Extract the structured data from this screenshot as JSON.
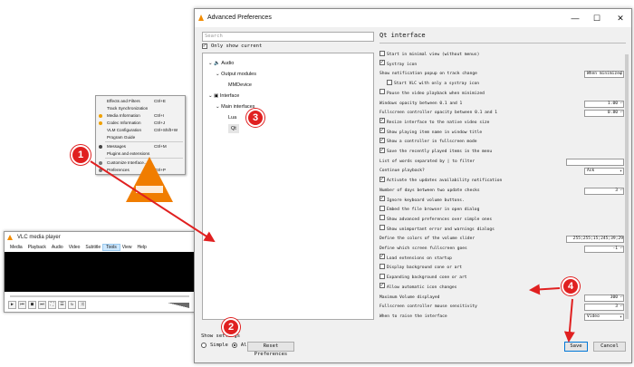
{
  "vlc": {
    "title": "VLC media player",
    "menu": [
      "Media",
      "Playback",
      "Audio",
      "Video",
      "Subtitle",
      "Tools",
      "View",
      "Help"
    ],
    "tools_menu": [
      {
        "label": "Effects and Filters",
        "shortcut": "Ctrl+E"
      },
      {
        "label": "Track Synchronization",
        "shortcut": ""
      },
      {
        "label": "Media Information",
        "shortcut": "Ctrl+I"
      },
      {
        "label": "Codec Information",
        "shortcut": "Ctrl+J"
      },
      {
        "label": "VLM Configuration",
        "shortcut": "Ctrl+Shift+W"
      },
      {
        "label": "Program Guide",
        "shortcut": ""
      },
      {
        "label": "Messages",
        "shortcut": "Ctrl+M"
      },
      {
        "label": "Plugins and extensions",
        "shortcut": ""
      },
      {
        "label": "Customize Interface...",
        "shortcut": ""
      },
      {
        "label": "Preferences",
        "shortcut": "Ctrl+P"
      }
    ]
  },
  "prefs": {
    "title": "Advanced Preferences",
    "search_placeholder": "Search",
    "only_current": "Only show current",
    "tree": [
      {
        "label": "Audio",
        "level": 0
      },
      {
        "label": "Output modules",
        "level": 1
      },
      {
        "label": "MMDevice",
        "level": 2
      },
      {
        "label": "Interface",
        "level": 0
      },
      {
        "label": "Main interfaces",
        "level": 1
      },
      {
        "label": "Lua",
        "level": 2
      },
      {
        "label": "Qt",
        "level": 2
      }
    ],
    "show_settings": "Show settings",
    "simple": "Simple",
    "all": "All",
    "reset_button": "Reset Preferences",
    "save_button": "Save",
    "cancel_button": "Cancel",
    "section_title": "Qt interface",
    "options": [
      {
        "type": "check",
        "label": "Start in minimal view (without menus)",
        "checked": false,
        "indent": 0
      },
      {
        "type": "check",
        "label": "Systray icon",
        "checked": true,
        "indent": 0
      },
      {
        "type": "combo",
        "label": "Show notification popup on track change",
        "value": "When minimized"
      },
      {
        "type": "check",
        "label": "Start VLC with only a systray icon",
        "checked": false,
        "indent": 1
      },
      {
        "type": "check",
        "label": "Pause the video playback when minimized",
        "checked": false,
        "indent": 0
      },
      {
        "type": "spin",
        "label": "Windows opacity between 0.1 and 1",
        "value": "1.00"
      },
      {
        "type": "spin",
        "label": "Fullscreen controller opacity between 0.1 and 1",
        "value": "0.80"
      },
      {
        "type": "check",
        "label": "Resize interface to the native video size",
        "checked": true,
        "indent": 0
      },
      {
        "type": "check",
        "label": "Show playing item name in window title",
        "checked": true,
        "indent": 0
      },
      {
        "type": "check",
        "label": "Show a controller in fullscreen mode",
        "checked": true,
        "indent": 0
      },
      {
        "type": "check",
        "label": "Save the recently played items in the menu",
        "checked": true,
        "indent": 0
      },
      {
        "type": "text",
        "label": "List of words separated by | to filter",
        "value": ""
      },
      {
        "type": "combo",
        "label": "Continue playback?",
        "value": "Ask"
      },
      {
        "type": "check",
        "label": "Activate the updates availability notification",
        "checked": true,
        "indent": 0
      },
      {
        "type": "spin",
        "label": "Number of days between two update checks",
        "value": "3"
      },
      {
        "type": "check",
        "label": "Ignore keyboard volume buttons.",
        "checked": true,
        "indent": 0
      },
      {
        "type": "check",
        "label": "Embed the file browser in open dialog",
        "checked": false,
        "indent": 0
      },
      {
        "type": "check",
        "label": "Show advanced preferences over simple ones",
        "checked": false,
        "indent": 0
      },
      {
        "type": "check",
        "label": "Show unimportant error and warnings dialogs",
        "checked": false,
        "indent": 0
      },
      {
        "type": "text",
        "label": "Define the colors of the volume slider",
        "value": "255;255;15;245;39;29"
      },
      {
        "type": "spin",
        "label": "Define which screen fullscreen goes",
        "value": "-1"
      },
      {
        "type": "check",
        "label": "Load extensions on startup",
        "checked": true,
        "indent": 0
      },
      {
        "type": "check",
        "label": "Display background cone or art",
        "checked": false,
        "indent": 0
      },
      {
        "type": "check",
        "label": "Expanding background cone or art",
        "checked": false,
        "indent": 0
      },
      {
        "type": "check",
        "label": "Allow automatic icon changes",
        "checked": true,
        "indent": 0
      },
      {
        "type": "spin",
        "label": "Maximum Volume displayed",
        "value": "300"
      },
      {
        "type": "spin",
        "label": "Fullscreen controller mouse sensitivity",
        "value": "3"
      },
      {
        "type": "combo",
        "label": "When to raise the interface",
        "value": "Video"
      }
    ]
  },
  "badges": [
    "1",
    "2",
    "3",
    "4"
  ],
  "colors": {
    "badge": "#e02020",
    "vlc_orange": "#f28c00",
    "arrow": "#e02020"
  }
}
